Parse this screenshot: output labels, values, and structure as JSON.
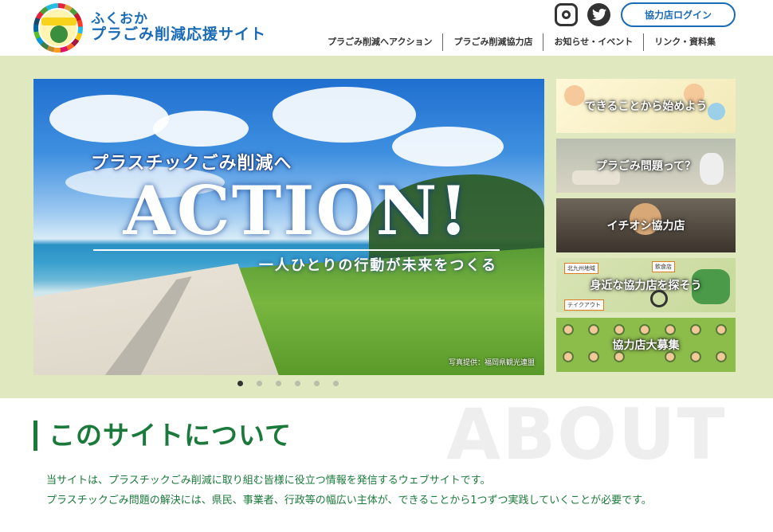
{
  "header": {
    "site_name_line1": "ふくおか",
    "site_name_line2": "プラごみ削減応援サイト",
    "login_label": "協力店ログイン",
    "social": [
      "instagram-icon",
      "twitter-icon"
    ],
    "nav": [
      "プラごみ削減へアクション",
      "プラごみ削減協力店",
      "お知らせ・イベント",
      "リンク・資料集"
    ]
  },
  "main_visual": {
    "headline_top": "プラスチックごみ削減へ",
    "headline_main": "ACTION!",
    "headline_bottom": "一人ひとりの行動が未来をつくる",
    "credit": "写真提供：福岡県観光連盟",
    "slide_count": 6,
    "active_slide": 1
  },
  "banners": [
    "できることから始めよう",
    "プラごみ問題って？",
    "イチオシ協力店",
    "身近な協力店を探そう",
    "協力店大募集"
  ],
  "banner_tags": {
    "area": "北九州地域",
    "shop": "飲食店",
    "takeout": "テイクアウト"
  },
  "about": {
    "bg_word": "ABOUT",
    "title": "このサイトについて",
    "text1": "当サイトは、プラスチックごみ削減に取り組む皆様に役立つ情報を発信するウェブサイトです。",
    "text2": "プラスチックごみ問題の解決には、県民、事業者、行政等の幅広い主体が、できることから1つずつ実践していくことが必要です。"
  },
  "colors": {
    "brand_blue": "#1a6bb5",
    "brand_green": "#1b7a3b",
    "hero_bg": "#dfe8bf"
  }
}
